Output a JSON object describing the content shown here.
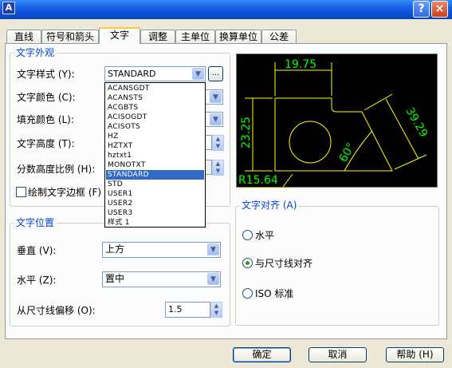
{
  "window": {
    "app_icon": "A",
    "help_button": "?",
    "close_button": "×"
  },
  "tabs": [
    "直线",
    "符号和箭头",
    "文字",
    "调整",
    "主单位",
    "换算单位",
    "公差"
  ],
  "text_appearance": {
    "group_title": "文字外观",
    "text_style_label": "文字样式 (Y):",
    "text_style_value": "STANDARD",
    "browse_button": "...",
    "text_color_label": "文字颜色 (C):",
    "fill_color_label": "填充颜色 (L):",
    "text_height_label": "文字高度 (T):",
    "fraction_scale_label": "分数高度比例 (H):",
    "draw_frame_label": "绘制文字边框 (F)",
    "draw_frame_checked": false
  },
  "style_dropdown_options": [
    "ACANSGDT",
    "ACANSTS",
    "ACGBTS",
    "ACISOGDT",
    "ACISOTS",
    "HZ",
    "HZTXT",
    "hztxt1",
    "MONOTXT",
    "STANDARD",
    "STD",
    "USER1",
    "USER2",
    "USER3",
    "样式 1"
  ],
  "style_dropdown_selected": "STANDARD",
  "preview": {
    "dim_top": "19.75",
    "dim_left": "23.25",
    "dim_right": "39.29",
    "dim_angle": "60°",
    "dim_radius": "R15.64"
  },
  "text_position": {
    "group_title": "文字位置",
    "vertical_label": "垂直 (V):",
    "vertical_value": "上方",
    "horizontal_label": "水平 (Z):",
    "horizontal_value": "置中",
    "offset_label": "从尺寸线偏移 (O):",
    "offset_value": "1.5"
  },
  "text_alignment": {
    "group_title": "文字对齐 (A)",
    "options": [
      "水平",
      "与尺寸线对齐",
      "ISO 标准"
    ],
    "selected": "与尺寸线对齐"
  },
  "buttons": {
    "ok": "确定",
    "cancel": "取消",
    "help": "帮助 (H)"
  },
  "colors": {
    "title_bar": "#0a4fd6",
    "preview_lines": "#ffff00",
    "preview_text": "#00ff00",
    "group_title": "#0046d5",
    "selection": "#316ac5"
  }
}
